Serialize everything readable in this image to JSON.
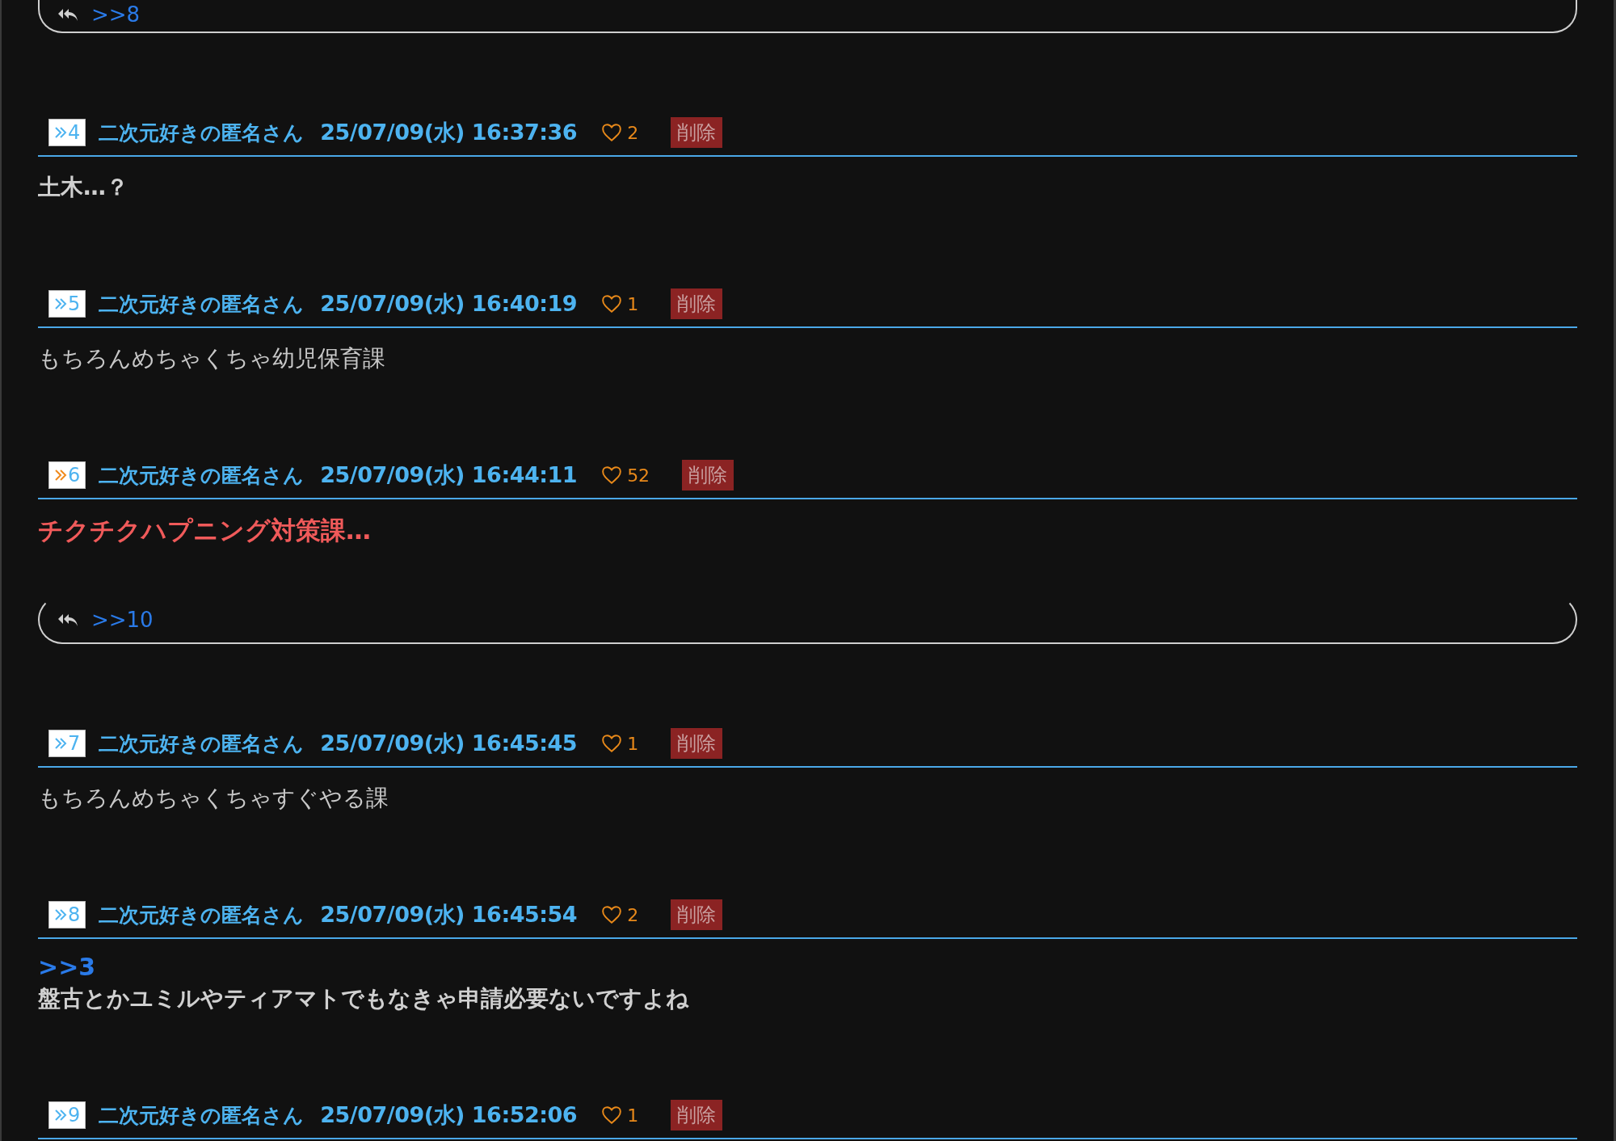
{
  "top_reply": {
    "link": ">>8"
  },
  "posts": [
    {
      "number": "4",
      "hot": false,
      "name": "二次元好きの匿名さん",
      "date": "25/07/09(水) 16:37:36",
      "likes": "2",
      "delete": "削除",
      "body": [
        {
          "kind": "bold",
          "text": "土木…？"
        }
      ]
    },
    {
      "number": "5",
      "hot": false,
      "name": "二次元好きの匿名さん",
      "date": "25/07/09(水) 16:40:19",
      "likes": "1",
      "delete": "削除",
      "body": [
        {
          "kind": "plain",
          "text": "もちろんめちゃくちゃ幼児保育課"
        }
      ]
    },
    {
      "number": "6",
      "hot": true,
      "name": "二次元好きの匿名さん",
      "date": "25/07/09(水) 16:44:11",
      "likes": "52",
      "delete": "削除",
      "body": [
        {
          "kind": "red",
          "text": "チクチクハプニング対策課…"
        }
      ],
      "reply": ">>10"
    },
    {
      "number": "7",
      "hot": false,
      "name": "二次元好きの匿名さん",
      "date": "25/07/09(水) 16:45:45",
      "likes": "1",
      "delete": "削除",
      "body": [
        {
          "kind": "plain",
          "text": "もちろんめちゃくちゃすぐやる課"
        }
      ]
    },
    {
      "number": "8",
      "hot": false,
      "name": "二次元好きの匿名さん",
      "date": "25/07/09(水) 16:45:54",
      "likes": "2",
      "delete": "削除",
      "body": [
        {
          "kind": "anchor",
          "text": ">>3"
        },
        {
          "kind": "bold",
          "text": "盤古とかユミルやティアマトでもなきゃ申請必要ないですよね"
        }
      ]
    },
    {
      "number": "9",
      "hot": false,
      "name": "二次元好きの匿名さん",
      "date": "25/07/09(水) 16:52:06",
      "likes": "1",
      "delete": "削除"
    }
  ]
}
